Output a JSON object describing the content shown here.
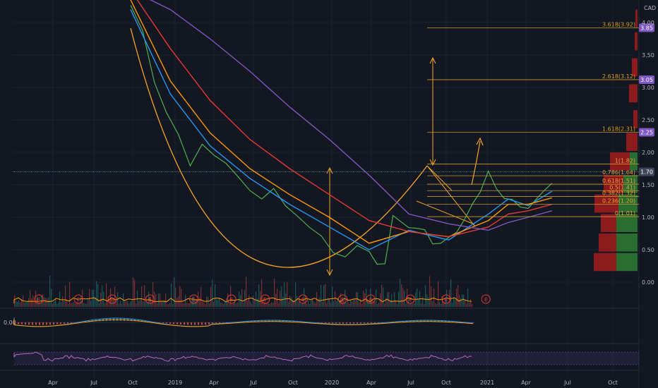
{
  "chart_data": {
    "type": "line",
    "currency": "CAD",
    "x_ticks": [
      "Apr",
      "Jul",
      "Oct",
      "2019",
      "Apr",
      "Jul",
      "Oct",
      "2020",
      "Apr",
      "Jul",
      "Oct",
      "2021",
      "Apr",
      "Jul",
      "Oct"
    ],
    "y_ticks": [
      "4.00",
      "3.50",
      "3.00",
      "2.50",
      "2.00",
      "1.50",
      "1.00",
      "0.50",
      "0.00"
    ],
    "ylim": [
      0.0,
      4.2
    ],
    "grid": true,
    "current_price": "1.70",
    "colors": {
      "price": "#4caf50",
      "ema_fast": "#2196f3",
      "ema_mid": "#ff9800",
      "ema_slow": "#e53935",
      "ema_long": "#7e57c2",
      "fib": "#c8962a",
      "tag_purple": "#7e57c2",
      "tag_price": "#3d4658"
    },
    "series": [
      {
        "x": [
          0.0,
          0.3,
          0.6,
          0.9,
          1.2,
          1.5,
          1.8,
          2.1,
          2.4,
          2.7,
          3.0,
          3.3,
          3.6,
          3.9,
          4.2,
          4.5,
          4.8,
          5.1,
          5.4,
          5.7,
          6.0,
          6.2,
          6.4,
          6.6,
          6.8,
          7.0,
          7.2,
          7.4,
          7.6,
          7.8,
          8.0,
          8.2,
          8.4,
          8.6,
          8.8,
          9.0,
          9.2,
          9.4,
          9.6,
          9.8,
          10.0,
          10.2,
          10.4,
          10.6
        ],
        "values": [
          4.28,
          3.9,
          3.05,
          2.6,
          2.25,
          1.8,
          2.15,
          1.95,
          1.8,
          1.65,
          1.4,
          1.3,
          1.45,
          1.15,
          1.0,
          0.85,
          0.7,
          0.48,
          0.37,
          0.55,
          0.45,
          0.3,
          0.28,
          1.02,
          0.9,
          0.82,
          0.8,
          0.78,
          0.62,
          0.6,
          0.68,
          0.75,
          0.95,
          1.2,
          1.38,
          1.72,
          1.45,
          1.3,
          1.25,
          1.15,
          1.15,
          1.25,
          1.38,
          1.55
        ]
      },
      {
        "x": [
          0.0,
          1.0,
          2.0,
          3.0,
          4.0,
          5.0,
          6.0,
          7.0,
          8.0,
          9.0,
          9.5,
          10.0,
          10.6
        ],
        "values": [
          4.2,
          2.9,
          2.1,
          1.6,
          1.2,
          0.85,
          0.5,
          0.8,
          0.65,
          1.05,
          1.28,
          1.18,
          1.4
        ]
      },
      {
        "x": [
          0.0,
          1.0,
          2.0,
          3.0,
          4.0,
          5.0,
          6.0,
          7.0,
          8.0,
          9.0,
          9.5,
          10.0,
          10.6
        ],
        "values": [
          4.35,
          3.1,
          2.3,
          1.75,
          1.35,
          1.0,
          0.6,
          0.78,
          0.7,
          0.95,
          1.2,
          1.2,
          1.3
        ]
      },
      {
        "x": [
          0.0,
          1.0,
          2.0,
          3.0,
          4.0,
          5.0,
          6.0,
          7.0,
          8.0,
          9.0,
          9.5,
          10.0,
          10.6
        ],
        "values": [
          4.5,
          3.6,
          2.8,
          2.2,
          1.75,
          1.35,
          0.95,
          0.78,
          0.7,
          0.85,
          1.05,
          1.1,
          1.2
        ]
      },
      {
        "x": [
          0.0,
          1.0,
          2.0,
          3.0,
          4.0,
          5.0,
          6.0,
          7.0,
          8.0,
          9.0,
          9.5,
          10.0,
          10.6
        ],
        "values": [
          4.5,
          4.2,
          3.75,
          3.25,
          2.7,
          2.2,
          1.65,
          1.05,
          0.9,
          0.8,
          0.92,
          1.0,
          1.1
        ]
      }
    ],
    "fib_levels": [
      {
        "label": "3.618(3.92)",
        "value": 3.92,
        "tag": "3.85"
      },
      {
        "label": "2.618(3.12)",
        "value": 3.12,
        "tag": "3.05"
      },
      {
        "label": "1.618(2.31)",
        "value": 2.31,
        "tag": "2.25"
      },
      {
        "label": "1(1.82)",
        "value": 1.82
      },
      {
        "label": "0.786(1.64)",
        "value": 1.64
      },
      {
        "label": "0.618(1.51)",
        "value": 1.51
      },
      {
        "label": "0.5(1.41)",
        "value": 1.41
      },
      {
        "label": "0.382(1.32)",
        "value": 1.32
      },
      {
        "label": "0.236(1.20)",
        "value": 1.2
      },
      {
        "label": "0(1.01)",
        "value": 1.01
      }
    ],
    "earnings_marker": "E",
    "earnings_x": [
      0.05,
      1.05,
      1.9,
      2.85,
      3.95,
      4.9,
      5.75,
      6.7,
      7.7,
      8.4,
      9.4,
      10.3,
      11.3
    ],
    "volume_profile": [
      {
        "p": 0.3,
        "up": 30,
        "down": 32
      },
      {
        "p": 0.6,
        "up": 30,
        "down": 25
      },
      {
        "p": 0.9,
        "up": 30,
        "down": 22
      },
      {
        "p": 1.2,
        "up": 27,
        "down": 34
      },
      {
        "p": 1.5,
        "up": 20,
        "down": 28
      },
      {
        "p": 1.85,
        "up": 11,
        "down": 28
      },
      {
        "p": 2.15,
        "up": 0,
        "down": 16
      },
      {
        "p": 2.5,
        "up": 0,
        "down": 6
      },
      {
        "p": 2.9,
        "up": 0,
        "down": 12
      },
      {
        "p": 3.3,
        "up": 0,
        "down": 8
      },
      {
        "p": 3.7,
        "up": 0,
        "down": 4
      },
      {
        "p": 4.05,
        "up": 0,
        "down": 3
      }
    ],
    "macd_label": "0.00"
  }
}
